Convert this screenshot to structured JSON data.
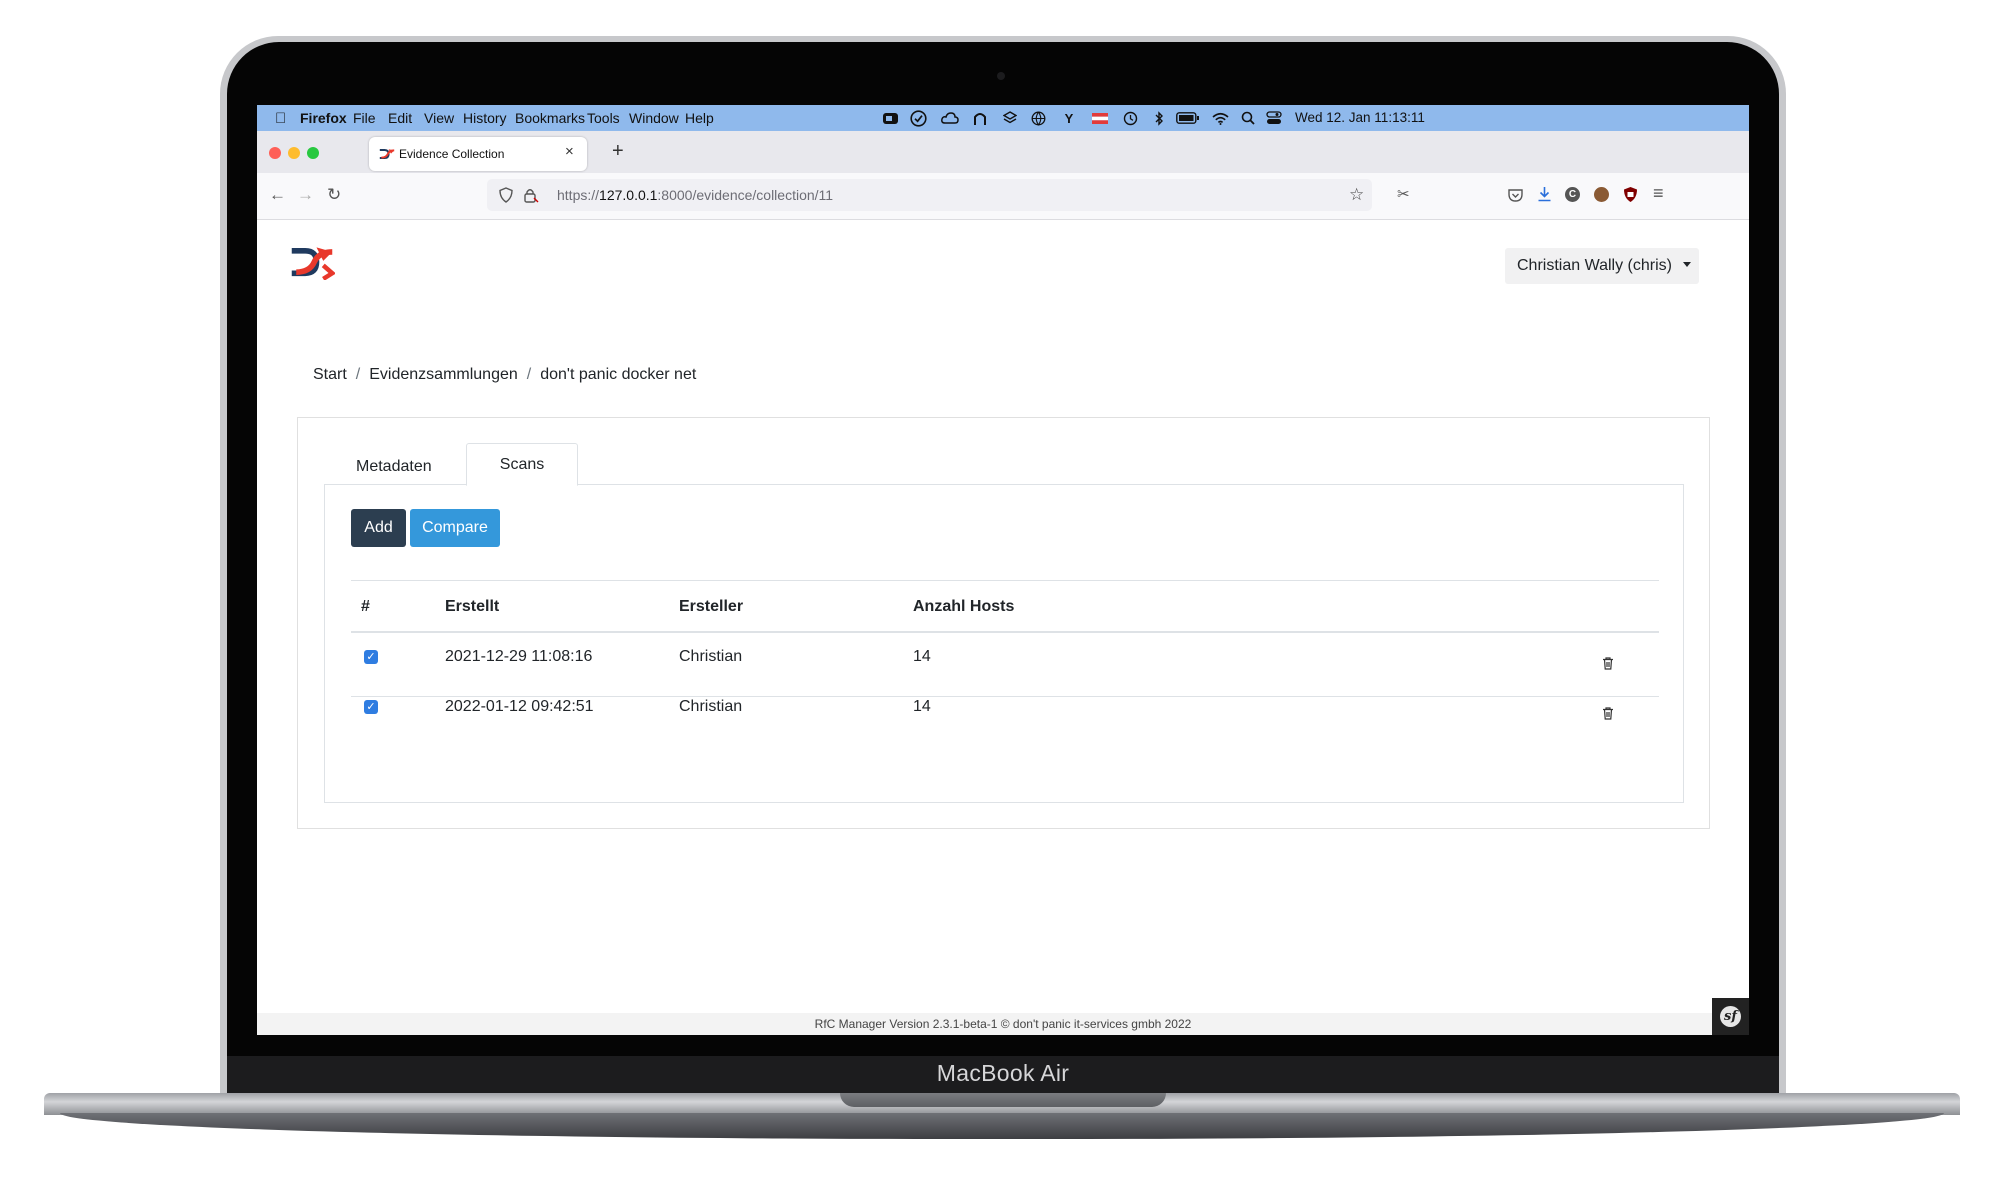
{
  "device": {
    "label": "MacBook Air"
  },
  "menubar": {
    "app": "Firefox",
    "items": [
      "File",
      "Edit",
      "View",
      "History",
      "Bookmarks",
      "Tools",
      "Window",
      "Help"
    ],
    "clock": "Wed 12. Jan  11:13:11",
    "status_icons": [
      "zoom-icon",
      "check-circle-icon",
      "cloud-icon",
      "arch-icon",
      "layers-icon",
      "globe-icon",
      "antenna-icon",
      "flag-icon",
      "time-machine-icon",
      "bluetooth-icon",
      "battery-icon",
      "wifi-icon",
      "spotlight-icon",
      "control-center-icon"
    ]
  },
  "browser": {
    "tab_title": "Evidence Collection",
    "url_scheme": "https://",
    "url_host": "127.0.0.1",
    "url_rest": ":8000/evidence/collection/11"
  },
  "header": {
    "user_menu": "Christian Wally (chris)"
  },
  "breadcrumb": {
    "items": [
      "Start",
      "Evidenzsammlungen",
      "don't panic docker net"
    ]
  },
  "tabs": {
    "metadata": "Metadaten",
    "scans": "Scans"
  },
  "toolbar": {
    "add": "Add",
    "compare": "Compare"
  },
  "table": {
    "columns": [
      "#",
      "Erstellt",
      "Ersteller",
      "Anzahl Hosts"
    ],
    "rows": [
      {
        "checked": true,
        "created": "2021-12-29 11:08:16",
        "creator": "Christian",
        "hosts": "14"
      },
      {
        "checked": true,
        "created": "2022-01-12 09:42:51",
        "creator": "Christian",
        "hosts": "14"
      }
    ]
  },
  "footer": {
    "text": "RfC Manager Version 2.3.1-beta-1    © don't panic it-services gmbh 2022"
  },
  "colors": {
    "menubar": "#8fb9ec",
    "primary_dark": "#2c3e50",
    "primary_blue": "#3498db",
    "logo_red": "#e8382b",
    "logo_navy": "#1f3a5f"
  }
}
